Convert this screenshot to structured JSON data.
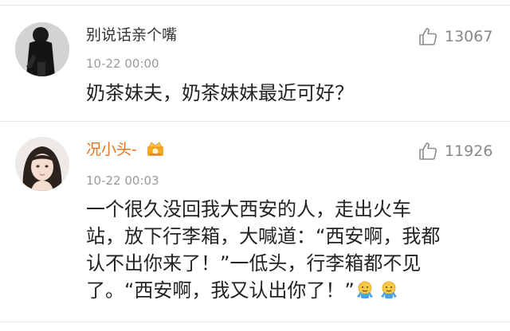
{
  "comments": [
    {
      "username": "别说话亲个嘴",
      "timestamp": "10-22 00:00",
      "likes": "13067",
      "content_lines": [
        "奶茶妹夫，奶茶妹妹最近可好？"
      ],
      "avatar_icon": "avatar-dark-figure",
      "username_color": "#333333"
    },
    {
      "username": "况小头-",
      "timestamp": "10-22 00:03",
      "likes": "11926",
      "content_lines": [
        "一个很久没回我大西安的人，走出火车",
        "站，放下行李箱，大喊道：“西安啊，我都",
        "认不出你来了！”一低头，行李箱都不见",
        "了。“西安啊，我又认出你了！”"
      ],
      "avatar_icon": "avatar-girl-portrait",
      "badge_icon": "crown-badge-icon",
      "trailing_emojis": [
        "shrug-emoji-icon",
        "shrug-emoji-icon"
      ],
      "username_color": "#e8731a"
    }
  ],
  "icons": {
    "like": "thumbs-up-icon"
  },
  "colors": {
    "username_highlight": "#e8731a",
    "meta_text": "#9a9a9a",
    "divider": "#e9e9e9"
  }
}
